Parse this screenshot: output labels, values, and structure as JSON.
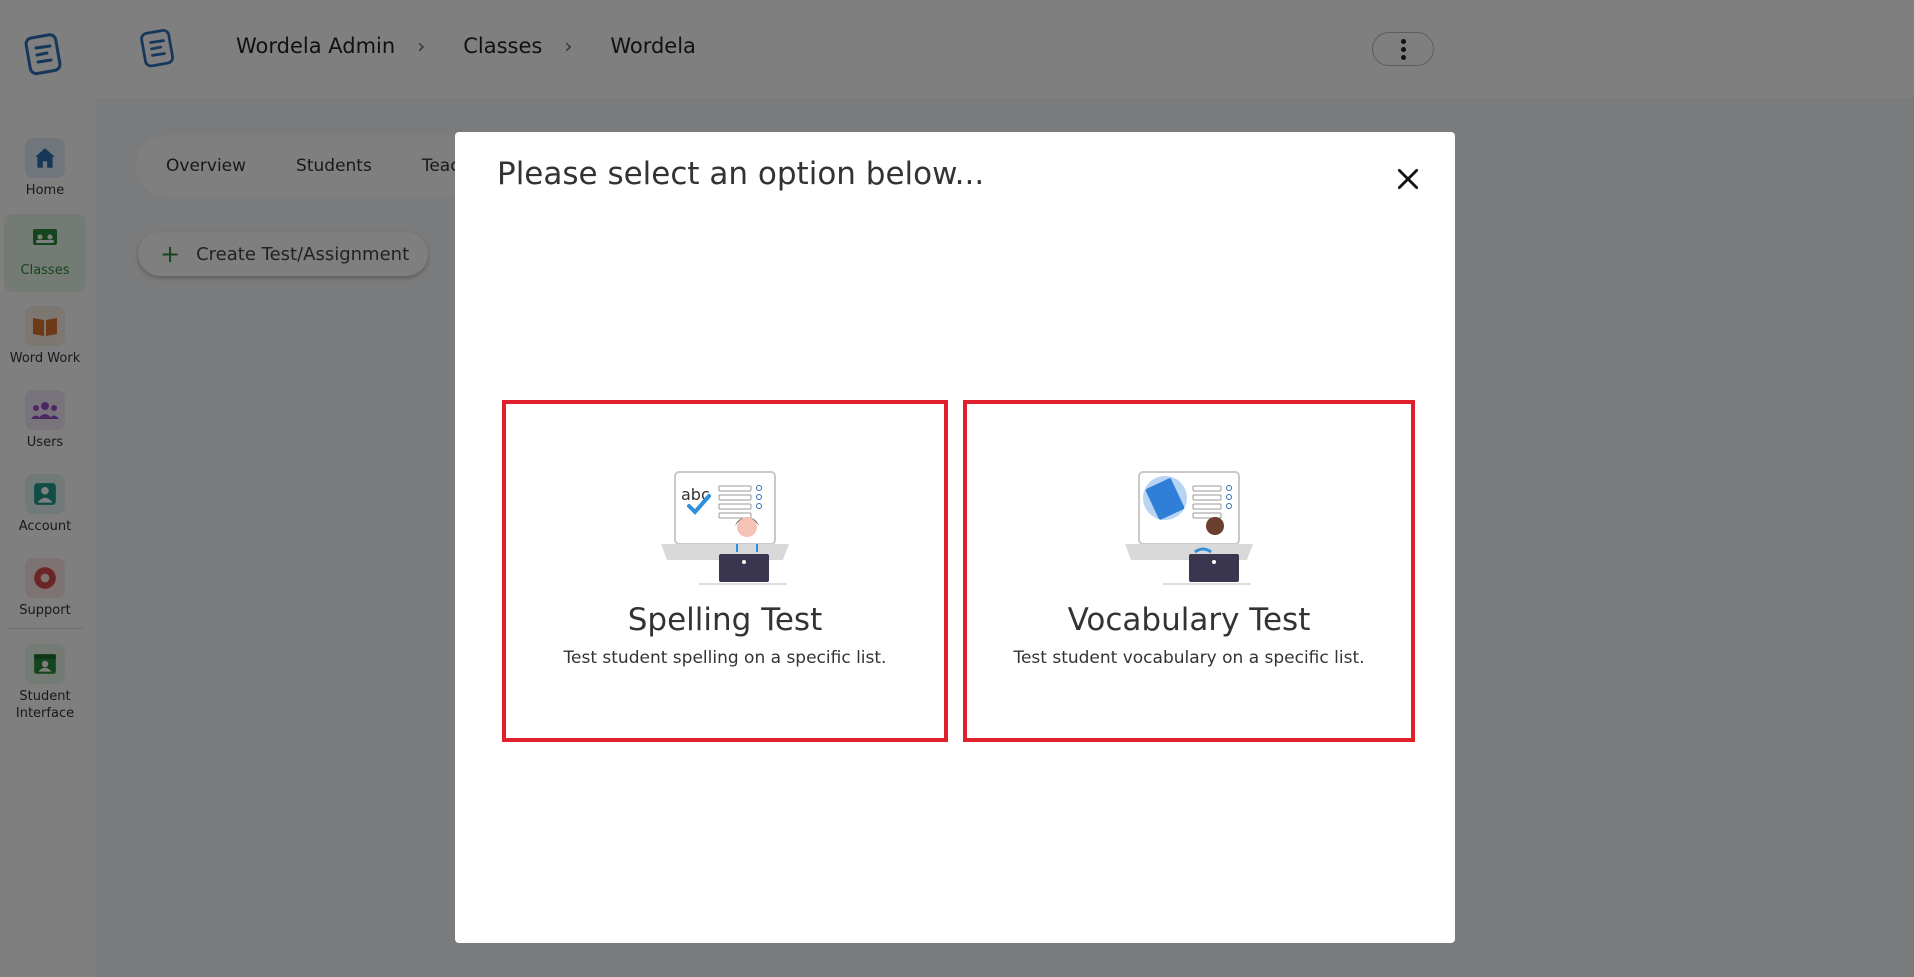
{
  "sidebar": {
    "items": [
      {
        "label": "Home",
        "icon": "home-icon",
        "color": "#2f6fb5"
      },
      {
        "label": "Classes",
        "icon": "classes-icon",
        "color": "#2a8a3a"
      },
      {
        "label": "Word Work",
        "icon": "book-icon",
        "color": "#d9742f"
      },
      {
        "label": "Users",
        "icon": "users-icon",
        "color": "#9b4fc7"
      },
      {
        "label": "Account",
        "icon": "account-icon",
        "color": "#1f9a8a"
      },
      {
        "label": "Support",
        "icon": "support-icon",
        "color": "#d94a4a"
      },
      {
        "label": "Student Interface",
        "icon": "student-interface-icon",
        "color": "#2a8a3a"
      }
    ]
  },
  "header": {
    "breadcrumb": [
      "Wordela Admin",
      "Classes",
      "Wordela"
    ]
  },
  "page": {
    "tabs": [
      "Overview",
      "Students",
      "Teac"
    ],
    "create_label": "Create Test/Assignment"
  },
  "modal": {
    "title": "Please select an option below...",
    "options": [
      {
        "title": "Spelling Test",
        "desc": "Test student spelling on a specific list.",
        "illus_text": "abc"
      },
      {
        "title": "Vocabulary Test",
        "desc": "Test student vocabulary on a specific list."
      }
    ],
    "highlight_color": "#e0202a"
  }
}
